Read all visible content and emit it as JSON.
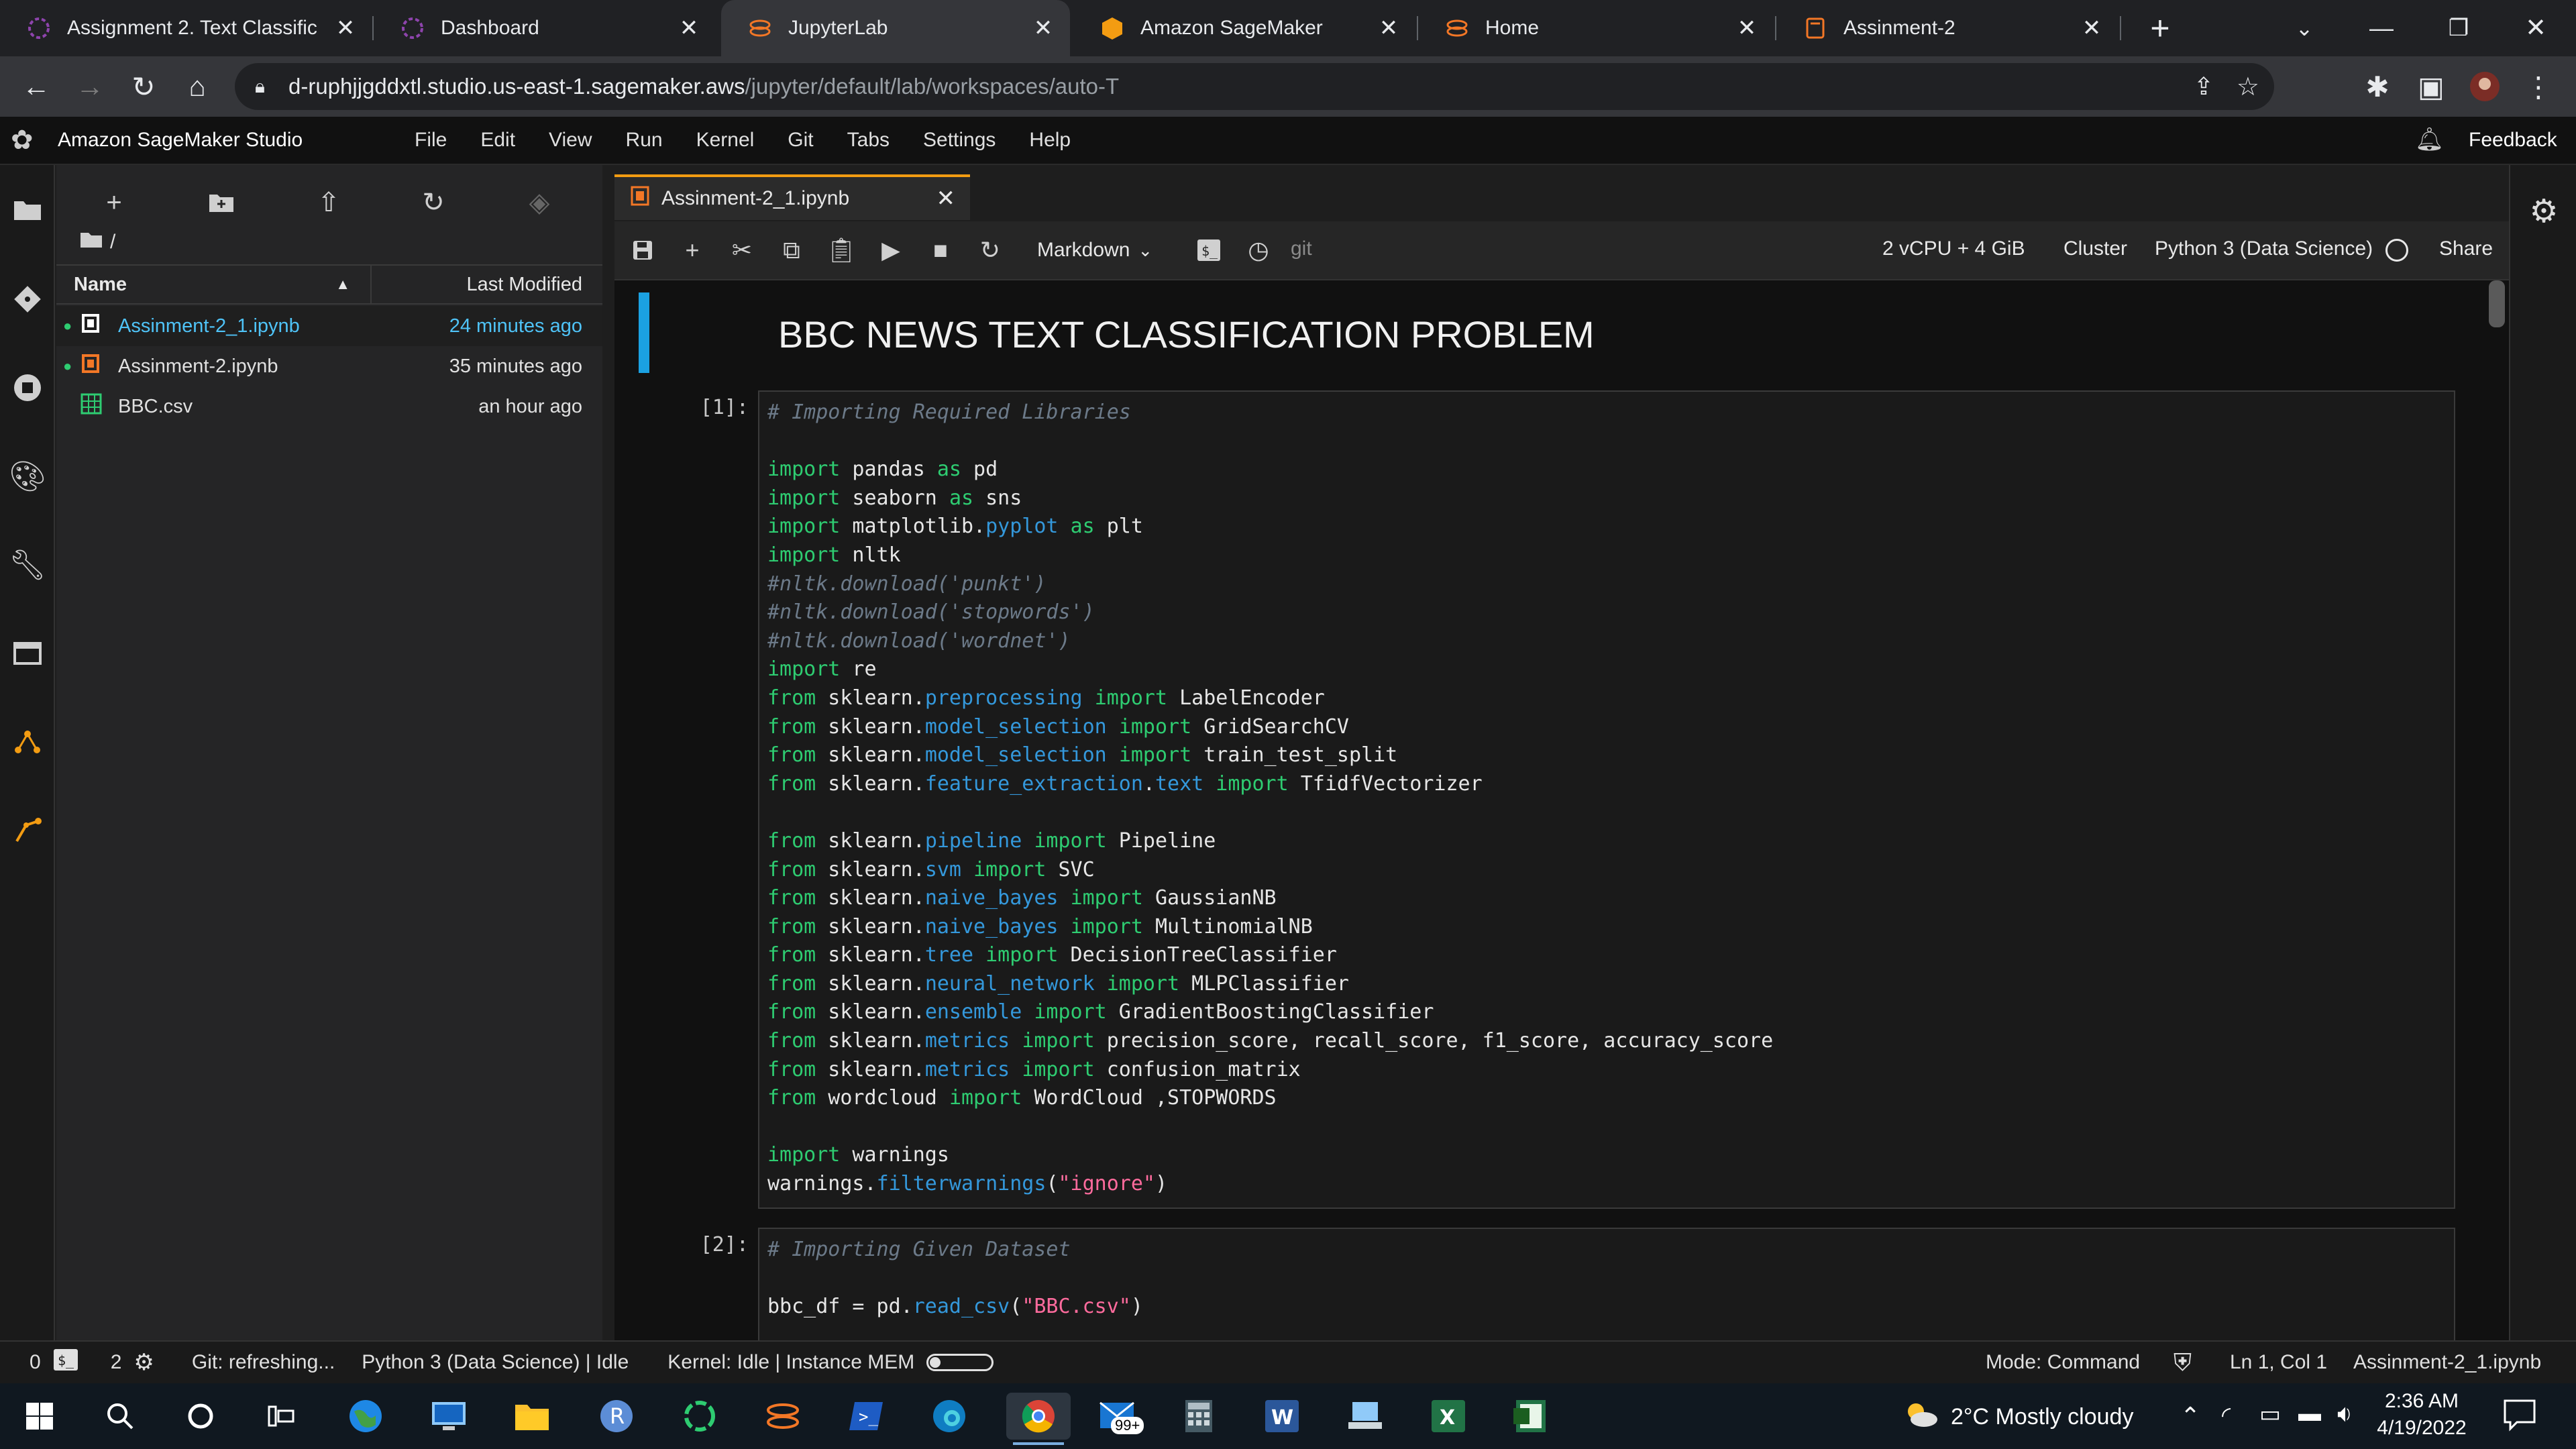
{
  "browser": {
    "tabs": [
      {
        "title": "Assignment 2. Text Classific",
        "icon": "sagemaker-purple-icon"
      },
      {
        "title": "Dashboard",
        "icon": "sagemaker-purple-icon"
      },
      {
        "title": "JupyterLab",
        "icon": "jupyter-icon"
      },
      {
        "title": "Amazon SageMaker",
        "icon": "aws-orange-icon"
      },
      {
        "title": "Home",
        "icon": "jupyter-icon"
      },
      {
        "title": "Assinment-2",
        "icon": "notebook-icon"
      }
    ],
    "new_tab": "+",
    "url_host": "d-ruphjjgddxtl.studio.us-east-1.sagemaker.aws",
    "url_path": "/jupyter/default/lab/workspaces/auto-T"
  },
  "studio": {
    "title": "Amazon SageMaker Studio",
    "menu": [
      "File",
      "Edit",
      "View",
      "Run",
      "Kernel",
      "Git",
      "Tabs",
      "Settings",
      "Help"
    ],
    "feedback": "Feedback"
  },
  "filebrowser": {
    "path": "/",
    "col_name": "Name",
    "col_modified": "Last Modified",
    "files": [
      {
        "name": "Assinment-2_1.ipynb",
        "modified": "24 minutes ago"
      },
      {
        "name": "Assinment-2.ipynb",
        "modified": "35 minutes ago"
      },
      {
        "name": "BBC.csv",
        "modified": "an hour ago"
      }
    ]
  },
  "notebook": {
    "tab_title": "Assinment-2_1.ipynb",
    "cell_type": "Markdown",
    "git_label": "git",
    "resources": "2 vCPU + 4 GiB",
    "cluster": "Cluster",
    "kernel": "Python 3 (Data Science)",
    "share": "Share",
    "heading": "BBC NEWS TEXT CLASSIFICATION PROBLEM",
    "prompt1": "[1]:",
    "prompt2": "[2]:",
    "cell2_comment": "# Importing Given Dataset",
    "cell2_line": {
      "var": "bbc_df",
      "op": " = pd.",
      "fn": "read_csv",
      "arg": "\"BBC.csv\""
    }
  },
  "status": {
    "terminals": "0",
    "kernels": "2",
    "git": "Git: refreshing...",
    "kernel_state": "Python 3 (Data Science) | Idle",
    "kernel_mem": "Kernel: Idle | Instance MEM",
    "mode": "Mode: Command",
    "position": "Ln 1, Col 1",
    "file": "Assinment-2_1.ipynb"
  },
  "taskbar": {
    "weather": "2°C  Mostly cloudy",
    "time": "2:36 AM",
    "date": "4/19/2022",
    "mail_badge": "99+"
  }
}
